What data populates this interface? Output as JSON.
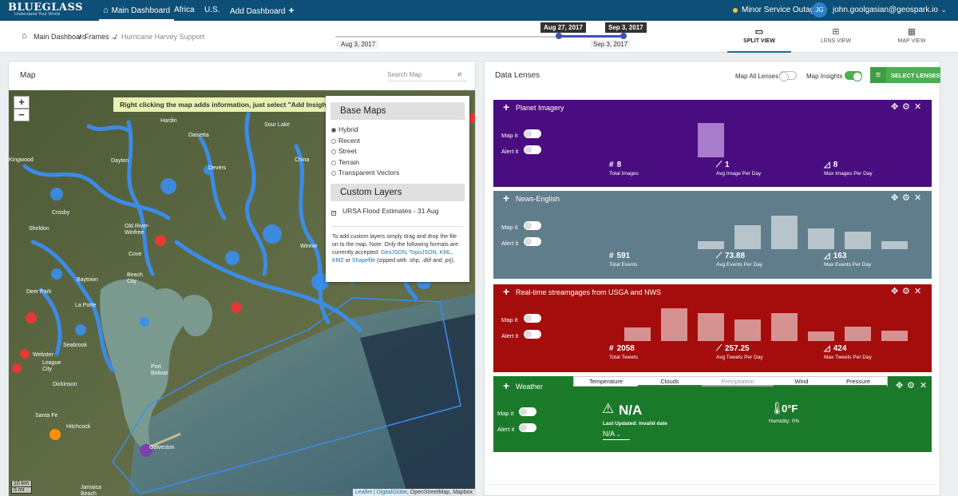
{
  "brand": {
    "name": "BLUEGLASS",
    "tagline": "Understand Your World"
  },
  "nav": {
    "main_dashboard": "Main Dashboard",
    "africa": "Africa",
    "us": "U.S.",
    "add_dashboard": "Add Dashboard",
    "add_icon": "+"
  },
  "status": {
    "text": "Minor Service Outage",
    "color": "#f6c343"
  },
  "user": {
    "initials": "JG",
    "email": "john.goolgasian@geospark.io"
  },
  "breadcrumb": {
    "main": "Main Dashboard",
    "sep": "/",
    "frames": "Frames",
    "current": "Hurricane Harvey Support"
  },
  "timeline": {
    "start": "Aug 3, 2017",
    "end": "Sep 3, 2017",
    "range_start": "Aug 27, 2017",
    "range_end": "Sep 3, 2017"
  },
  "views": {
    "split": "SPLIT VIEW",
    "lens": "LENS VIEW",
    "map": "MAP VIEW"
  },
  "map": {
    "title": "Map",
    "search_placeholder": "Search Map",
    "hint": "Right clicking the map adds information, just select \"Add Insight\".",
    "base_maps_title": "Base Maps",
    "base_maps": [
      "Hybrid",
      "Recent",
      "Street",
      "Terrain",
      "Transparent Vectors"
    ],
    "custom_title": "Custom Layers",
    "custom_layer": "URSA Flood Estimates - 31 Aug",
    "note_pre": "To add custom layers simply drag and drop the file on to the map. Note: Only the following formats are currently accepted:",
    "formats": [
      "GeoJSON",
      "TopoJSON",
      "KML",
      "KMZ",
      "Shapefile"
    ],
    "note_post": "(zipped with .shp, .dbf and .prj).",
    "attribution_links": "Leaflet | DigitalGlobe",
    "attribution_rest": ", OpenStreetMap, Mapbox",
    "scale_km": "10 km",
    "scale_mi": "5 mi",
    "places": [
      "Hardin",
      "Sour Lake",
      "Daisetta",
      "Dayton",
      "Devers",
      "China",
      "Kingwood",
      "Crosby",
      "Old River-Winfree",
      "Sheldon",
      "Cove",
      "Winnie",
      "Baytown",
      "Beach City",
      "Deer Park",
      "La Porte",
      "Seabrook",
      "Webster",
      "League City",
      "Dickinson",
      "Santa Fe",
      "Hitchcock",
      "Port Bolivar",
      "Galveston",
      "Jamaica Beach"
    ]
  },
  "lenses": {
    "title": "Data Lenses",
    "map_all": "Map All Lenses",
    "insights": "Map Insights",
    "select": "SELECT LENSES",
    "map_it": "Map it",
    "alert_it": "Alert it",
    "cards": [
      {
        "title": "Planet Imagery",
        "color": "#4a0d80",
        "total": "8",
        "total_label": "Total Images",
        "avg": "1",
        "avg_label": "Avg Image Per Day",
        "max": "8",
        "max_label": "Max Images Per Day",
        "bars": [
          8
        ]
      },
      {
        "title": "News-English",
        "color": "#607d8b",
        "total": "591",
        "total_label": "Total Events",
        "avg": "73.88",
        "avg_label": "Avg Events Per Day",
        "max": "163",
        "max_label": "Max Events Per Day",
        "bars": [
          19,
          60,
          111,
          163,
          103,
          88,
          38
        ]
      },
      {
        "title": "Real-time streamgages from USGA and NWS",
        "color": "#a50d0d",
        "total": "2058",
        "total_label": "Total Tweets",
        "avg": "257.25",
        "avg_label": "Avg Tweets Per Day",
        "max": "424",
        "max_label": "Max Tweets Per Day",
        "bars": [
          172,
          424,
          360,
          278,
          360,
          127,
          186,
          132
        ]
      }
    ],
    "weather": {
      "title": "Weather",
      "color": "#1b7a2a",
      "tabs": [
        "Temperature",
        "Clouds",
        "Precipitation",
        "Wind",
        "Pressure"
      ],
      "value": "N/A",
      "updated": "Last Updated: Invalid date",
      "selected": "N/A",
      "temp": "0°F",
      "humidity": "Humidity: 0%"
    }
  }
}
